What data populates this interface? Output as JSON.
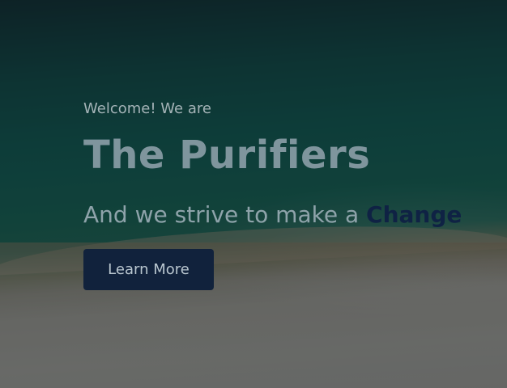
{
  "hero": {
    "welcome_text": "Welcome! We are",
    "title": "The Purifiers",
    "tagline_prefix": "And we strive to make a ",
    "tagline_accent": "Change",
    "cta_label": "Learn More"
  },
  "colors": {
    "accent": "#0f2244",
    "button_bg": "#11223c"
  }
}
